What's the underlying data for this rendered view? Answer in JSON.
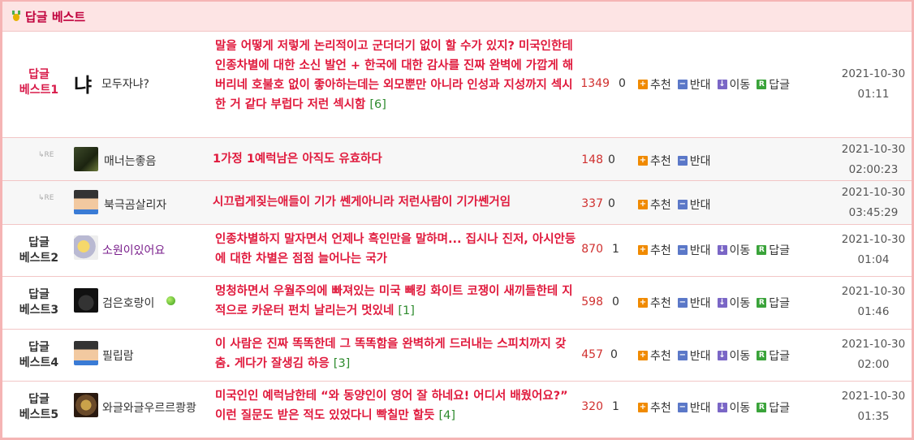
{
  "header": {
    "title": "답글 베스트",
    "icon": "carrot-icon"
  },
  "labels": {
    "recommend": "추천",
    "oppose": "반대",
    "move": "이동",
    "reply": "답글",
    "re": "RE"
  },
  "rows": [
    {
      "rank": [
        "답글",
        "베스트1"
      ],
      "nick": "모두자냐?",
      "nick_prefix": "냐",
      "content": "말을 어떻게 저렇게 논리적이고 군더더기 없이 할 수가 있지? 미국인한테 인종차별에 대한 소신 발언 + 한국에 대한 감사를 진짜 완벽에 가깝게 해버리네 호불호 없이 좋아하는데는 외모뿐만 아니라 인성과 지성까지 섹시한 거 같다 부럽다 저런 섹시함",
      "comments": "[6]",
      "views": "1349",
      "replies": "0",
      "date": "2021-10-30",
      "time": "01:11"
    },
    {
      "is_reply": true,
      "nick": "매너는좋음",
      "content": "1가정 1예럭남은 아직도 유효하다",
      "comments": "",
      "views": "148",
      "replies": "0",
      "date": "2021-10-30",
      "time": "02:00:23"
    },
    {
      "is_reply": true,
      "nick": "북극곰살리자",
      "content": "시끄럽게짖는애들이 기가 쎈게아니라 저런사람이 기가쎈거임",
      "comments": "",
      "views": "337",
      "replies": "0",
      "date": "2021-10-30",
      "time": "03:45:29"
    },
    {
      "rank": [
        "답글",
        "베스트2"
      ],
      "nick": "소원이있어요",
      "content": "인종차별하지 말자면서 언제나 흑인만을 말하며... 집시나 진저, 아시안등에 대한 차별은 점점 늘어나는 국가",
      "comments": "",
      "views": "870",
      "replies": "1",
      "date": "2021-10-30",
      "time": "01:04"
    },
    {
      "rank": [
        "답글",
        "베스트3"
      ],
      "nick": "검은호랑이",
      "content": "멍청하면서 우월주의에 빠져있는 미국 빼킹 화이트 코쟁이 새끼들한테 지적으로 카운터 펀치 날리는거 멋있네",
      "comments": "[1]",
      "views": "598",
      "replies": "0",
      "date": "2021-10-30",
      "time": "01:46"
    },
    {
      "rank": [
        "답글",
        "베스트4"
      ],
      "nick": "필립람",
      "content": "이 사람은 진짜 똑똑한데 그 똑똑함을 완벽하게 드러내는 스피치까지 갖춤. 게다가 잘생김 하응",
      "comments": "[3]",
      "views": "457",
      "replies": "0",
      "date": "2021-10-30",
      "time": "02:00"
    },
    {
      "rank": [
        "답글",
        "베스트5"
      ],
      "nick": "와글와글우르르쾅쾅",
      "content": "미국인인 예럭남한테 “와 동양인이 영어 잘 하네요! 어디서 배웠어요?” 이런 질문도 받은 적도 있었다니 빡칠만 할듯",
      "comments": "[4]",
      "views": "320",
      "replies": "1",
      "date": "2021-10-30",
      "time": "01:35"
    }
  ]
}
